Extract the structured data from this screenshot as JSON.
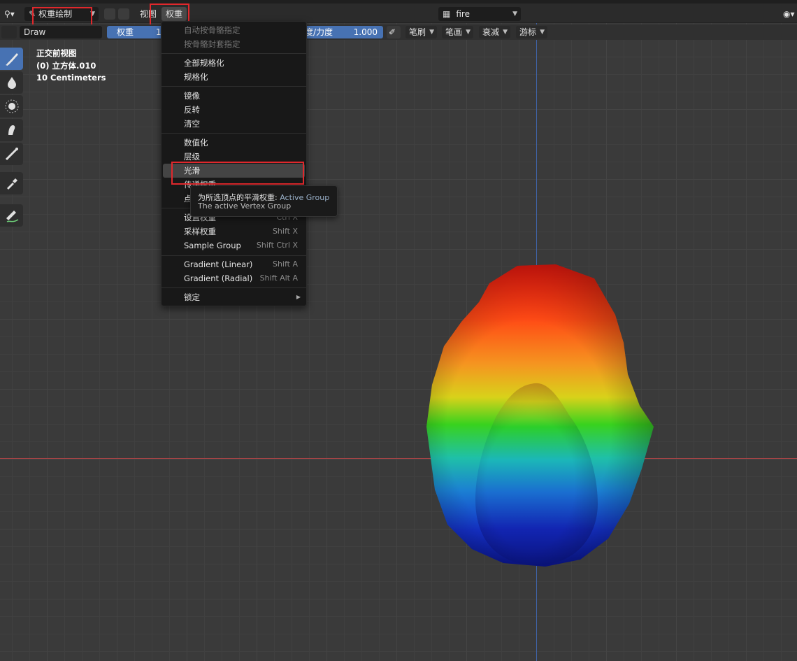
{
  "header": {
    "mode_label": "权重绘制",
    "menu_view": "视图",
    "menu_weights": "权重",
    "object_name": "fire"
  },
  "tool_settings": {
    "brush_name": "Draw",
    "weight_label": "权重",
    "weight_value": "1",
    "strength_label": "度/力度",
    "strength_value": "1.000",
    "brush_menu": "笔刷",
    "stroke_menu": "笔画",
    "falloff_menu": "衰减",
    "cursor_menu": "游标"
  },
  "overlay": {
    "view_name": "正交前视图",
    "object_info": "(0) 立方体.010",
    "scale": "10 Centimeters"
  },
  "weights_menu": {
    "items": [
      {
        "label": "自动按骨骼指定",
        "shortcut": ""
      },
      {
        "label": "按骨骼封套指定",
        "shortcut": ""
      },
      {
        "label": "全部规格化",
        "shortcut": ""
      },
      {
        "label": "规格化",
        "shortcut": ""
      },
      {
        "label": "镜像",
        "shortcut": ""
      },
      {
        "label": "反转",
        "shortcut": ""
      },
      {
        "label": "清空",
        "shortcut": ""
      },
      {
        "label": "数值化",
        "shortcut": ""
      },
      {
        "label": "层级",
        "shortcut": ""
      },
      {
        "label": "光滑",
        "shortcut": ""
      },
      {
        "label": "传递权重",
        "shortcut": ""
      },
      {
        "label": "点",
        "shortcut": ""
      },
      {
        "label": "设置权重",
        "shortcut": "Ctrl X"
      },
      {
        "label": "采样权重",
        "shortcut": "Shift X"
      },
      {
        "label": "Sample Group",
        "shortcut": "Shift Ctrl X"
      },
      {
        "label": "Gradient (Linear)",
        "shortcut": "Shift A"
      },
      {
        "label": "Gradient (Radial)",
        "shortcut": "Shift Alt A"
      },
      {
        "label": "锁定",
        "shortcut": ""
      }
    ]
  },
  "tooltip": {
    "line1": "为所选顶点的平滑权重:",
    "line1_value": "Active Group",
    "line2": "The active Vertex Group"
  },
  "colors": {
    "accent": "#4772b3",
    "highlight_box": "#e0282c",
    "menu_bg": "#181818"
  },
  "icons": [
    "editor-type-icon",
    "weight-paint-mode-icon",
    "draw-brush-icon",
    "blur-icon",
    "average-icon",
    "smear-icon",
    "gradient-icon",
    "sample-weight-icon",
    "annotate-icon",
    "visibility-icon"
  ]
}
